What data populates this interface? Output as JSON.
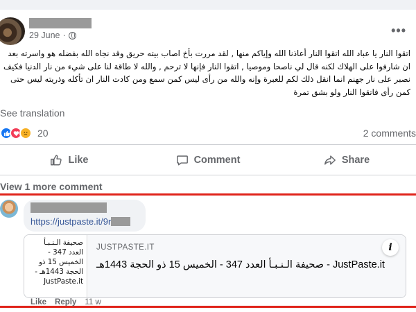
{
  "post": {
    "date": "29 June",
    "dot": "·",
    "more_glyph": "•••",
    "text": "اتقوا النار يا عباد الله اتقوا النار أعاذنا الله وإياكم منها , لقد مررت بأخ اصاب بيته حريق وقد نجاه الله بفضله هو واسرته بعد ان شارفوا على الهلاك لكنه قال لي ناصحا وموصيا , اتقوا النار فإنها لا ترحم , والله لا طاقة لنا على شيء من نار الدنيا فكيف نصبر على نار جهنم انما انقل ذلك لكم للعبرة وإنه والله من رأى ليس كمن سمع ومن كادت النار ان تأكله وذريته ليس حتى كمن رأى فاتقوا النار ولو بشق تمرة",
    "see_translation": "See translation",
    "reaction_count": "20",
    "comments_count": "2 comments"
  },
  "actions": {
    "like": "Like",
    "comment": "Comment",
    "share": "Share"
  },
  "comments": {
    "view_more": "View 1 more comment",
    "item": {
      "link_text": "https://justpaste.it/9r",
      "preview": {
        "thumb_text": "صحيفة الـنـبـأ العدد 347 - الخميس 15 ذو الحجة 1443هـ - JustPaste.it",
        "domain": "JUSTPASTE.IT",
        "title": "صحيفة الـنـبـأ العدد 347 - الخميس 15 ذو الحجة 1443هـ - JustPaste.it",
        "info_glyph": "i"
      },
      "like_label": "Like",
      "reply_label": "Reply",
      "age": "11 w"
    }
  },
  "colors": {
    "highlight_border": "#e0231a",
    "link": "#385898",
    "muted": "#65676b"
  },
  "icons": {
    "reactions": [
      "like-reaction-icon",
      "love-reaction-icon",
      "sad-reaction-icon"
    ]
  }
}
